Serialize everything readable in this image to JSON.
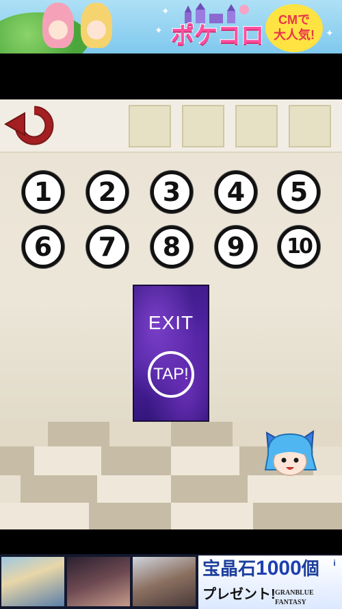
{
  "top_ad": {
    "brand": "ポケコロ",
    "badge_line1": "CMで",
    "badge_line2": "大人気!"
  },
  "number_buttons": [
    "1",
    "2",
    "3",
    "4",
    "5",
    "6",
    "7",
    "8",
    "9",
    "10"
  ],
  "door": {
    "label": "EXIT",
    "tap_label": "TAP!"
  },
  "bottom_ad": {
    "promo_line1_prefix": "宝晶石",
    "promo_line1_count": "1000",
    "promo_line1_suffix": "個",
    "promo_line2": "プレゼント!",
    "game_logo": "GRANBLUE FANTASY",
    "info": "i"
  }
}
